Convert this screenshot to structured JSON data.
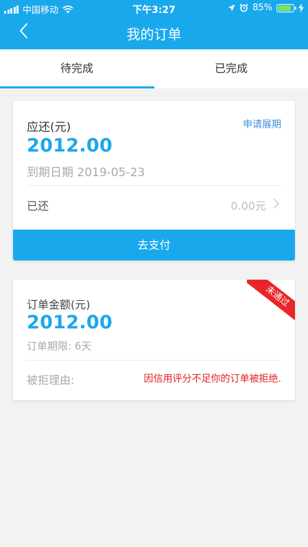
{
  "status_bar": {
    "carrier": "中国移动",
    "time": "下午3:27",
    "battery_percent": "85%",
    "battery_level": 0.85,
    "battery_fill_color": "#7ae35b"
  },
  "nav": {
    "back_icon": "chevron-left-icon",
    "title": "我的订单"
  },
  "tabs": {
    "pending": "待完成",
    "completed": "已完成"
  },
  "card_due": {
    "label": "应还(元)",
    "apply_extension": "申请展期",
    "amount": "2012.00",
    "due_date": "到期日期 2019-05-23",
    "paid_label": "已还",
    "paid_value": "0.00元",
    "pay_button": "去支付"
  },
  "card_order": {
    "label": "订单金额(元)",
    "amount": "2012.00",
    "term": "订单期限: 6天",
    "reject_label": "被拒理由:",
    "reject_reason": "因信用评分不足你的订单被拒绝.",
    "status_ribbon": "未通过"
  },
  "colors": {
    "accent": "#1aa8ec",
    "link": "#3d8ed9",
    "error": "#e02020",
    "ribbon": "#e8262a"
  }
}
